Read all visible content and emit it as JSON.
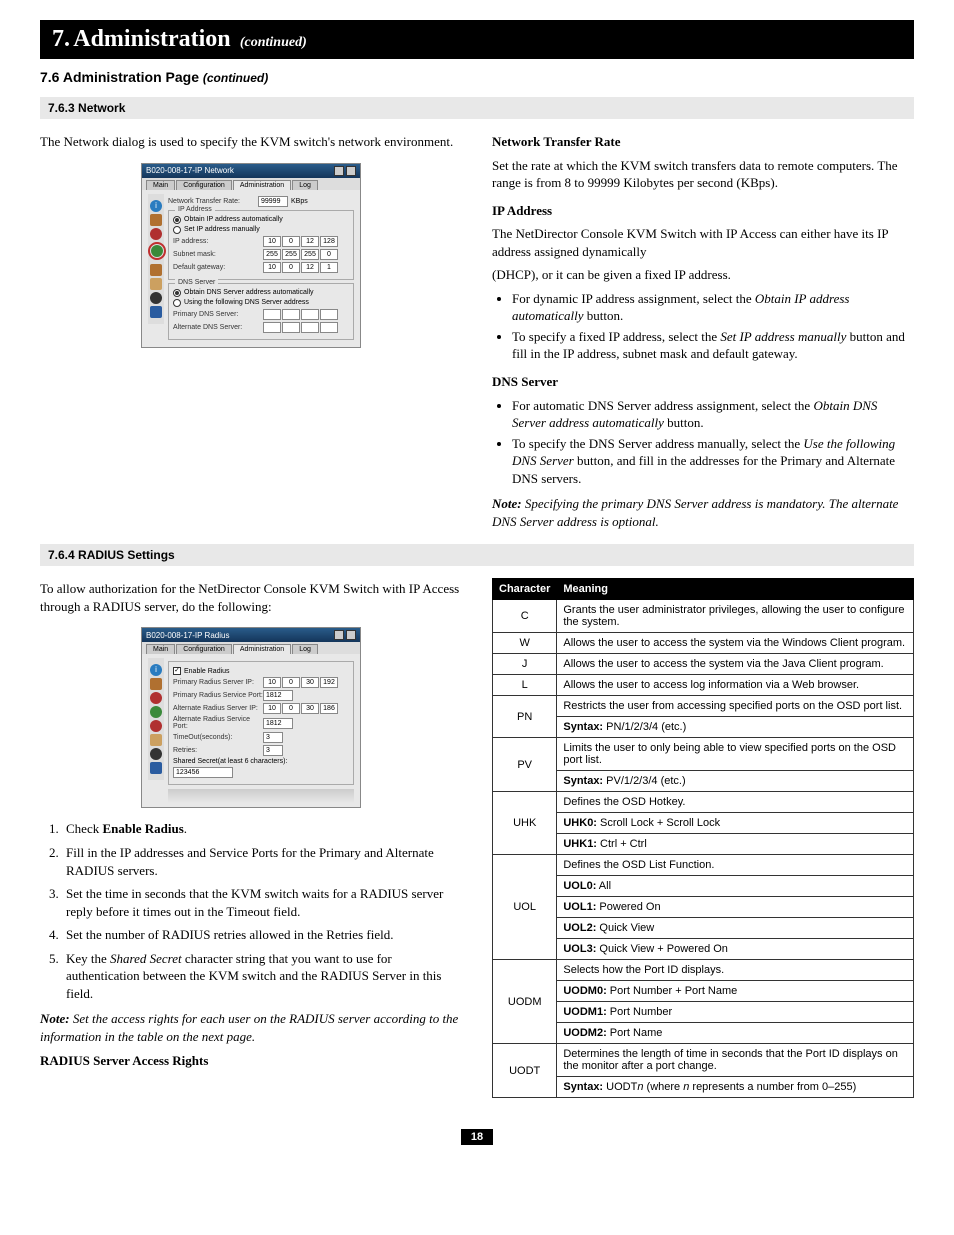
{
  "chapter": {
    "num": "7.",
    "title": "Administration",
    "continued": "(continued)"
  },
  "section": {
    "num": "7.6",
    "title": "Administration Page",
    "continued": "(continued)"
  },
  "sub763": {
    "num": "7.6.3",
    "title": "Network"
  },
  "sub764": {
    "num": "7.6.4",
    "title": "RADIUS Settings"
  },
  "intro763": "The Network dialog is used to specify the KVM switch's network environment.",
  "ntr": {
    "heading": "Network Transfer Rate",
    "body": "Set the rate at which the KVM switch transfers data to remote computers. The range is from 8 to 99999 Kilobytes per second (KBps)."
  },
  "ip": {
    "heading": "IP Address",
    "lead": "The NetDirector Console KVM Switch with IP Access can either have its IP address assigned dynamically",
    "lead2": "(DHCP), or it can be given a fixed IP address.",
    "b1a": "For dynamic IP address assignment, select the ",
    "b1i": "Obtain IP address automatically",
    "b1b": " button.",
    "b2a": "To specify a fixed IP address, select the ",
    "b2i": "Set IP address manually",
    "b2b": " button and fill in the IP address, subnet mask and default gateway."
  },
  "dns": {
    "heading": "DNS Server",
    "b1a": "For automatic DNS Server address assignment, select the ",
    "b1i": "Obtain DNS Server address automatically",
    "b1b": " button.",
    "b2a": "To specify the DNS Server address manually, select the ",
    "b2i": "Use the following DNS Server",
    "b2b": " button, and fill in the addresses for the Primary and Alternate DNS servers.",
    "noteLabel": "Note:",
    "noteBody": " Specifying the primary DNS Server address is mandatory. The alternate DNS Server address is optional."
  },
  "radius": {
    "intro": "To allow authorization for the NetDirector Console KVM Switch with IP Access through a RADIUS server, do the following:",
    "steps": {
      "s1a": "Check ",
      "s1b": "Enable Radius",
      "s1c": ".",
      "s2": "Fill in the IP addresses and Service Ports for the Primary and Alternate RADIUS servers.",
      "s3": "Set the time in seconds that the KVM switch waits for a RADIUS server reply before it times out in the Timeout field.",
      "s4": "Set the number of RADIUS retries allowed in the Retries field.",
      "s5a": "Key the ",
      "s5i": "Shared Secret",
      "s5b": " character string that you want to use for authentication between the KVM switch and the RADIUS Server in this field."
    },
    "noteLabel": "Note:",
    "noteBody": " Set the access rights for each user on the RADIUS server according to the information in the table on the next page.",
    "accessHeading": "RADIUS Server Access Rights"
  },
  "table": {
    "hChar": "Character",
    "hMean": "Meaning",
    "rows": [
      {
        "c": "C",
        "m": [
          "Grants the user administrator privileges, allowing the user to configure the system."
        ]
      },
      {
        "c": "W",
        "m": [
          "Allows the user to access the system via the Windows Client program."
        ]
      },
      {
        "c": "J",
        "m": [
          "Allows the user to access the system via the Java Client program."
        ]
      },
      {
        "c": "L",
        "m": [
          "Allows the user to access log information via a Web browser."
        ]
      },
      {
        "c": "PN",
        "m": [
          "Restricts the user from accessing specified ports on the OSD port list.",
          "<b>Syntax:</b> PN/1/2/3/4 (etc.)"
        ]
      },
      {
        "c": "PV",
        "m": [
          "Limits the user to only being able to view specified ports on the OSD port list.",
          "<b>Syntax:</b> PV/1/2/3/4 (etc.)"
        ]
      },
      {
        "c": "UHK",
        "m": [
          "Defines the OSD Hotkey.",
          "<b>UHK0:</b> Scroll Lock + Scroll Lock",
          "<b>UHK1:</b> Ctrl + Ctrl"
        ]
      },
      {
        "c": "UOL",
        "m": [
          "Defines the OSD List Function.",
          "<b>UOL0:</b> All",
          "<b>UOL1:</b> Powered On",
          "<b>UOL2:</b> Quick View",
          "<b>UOL3:</b> Quick View + Powered On"
        ]
      },
      {
        "c": "UODM",
        "m": [
          "Selects how the Port ID displays.",
          "<b>UODM0:</b> Port Number + Port Name",
          "<b>UODM1:</b> Port Number",
          "<b>UODM2:</b> Port Name"
        ]
      },
      {
        "c": "UODT",
        "m": [
          "Determines the length of time in seconds that the Port ID displays on the monitor after a port change.",
          "<b>Syntax:</b> UODT<i>n</i> (where <i>n</i> represents a number from 0–255)"
        ]
      }
    ]
  },
  "ssNet": {
    "title": "B020-008-17-IP Network",
    "tabs": [
      "Main",
      "Configuration",
      "Administration",
      "Log"
    ],
    "ntrLabel": "Network Transfer Rate:",
    "ntrVal": "99999",
    "ntrUnit": "KBps",
    "gIP": "IP Address",
    "r1": "Obtain IP address automatically",
    "r2": "Set IP address manually",
    "ipL": "IP address:",
    "ipV": [
      "10",
      "0",
      "12",
      "128"
    ],
    "smL": "Subnet mask:",
    "smV": [
      "255",
      "255",
      "255",
      "0"
    ],
    "gwL": "Default gateway:",
    "gwV": [
      "10",
      "0",
      "12",
      "1"
    ],
    "gDNS": "DNS Server",
    "d1": "Obtain DNS Server address automatically",
    "d2": "Using the following DNS Server address",
    "pdnsL": "Primary DNS Server:",
    "adnsL": "Alternate DNS Server:"
  },
  "ssRad": {
    "title": "B020-008-17-IP Radius",
    "tabs": [
      "Main",
      "Configuration",
      "Administration",
      "Log"
    ],
    "enable": "Enable Radius",
    "psL": "Primary Radius Server IP:",
    "psV": [
      "10",
      "0",
      "30",
      "192"
    ],
    "pspL": "Primary Radius Service Port:",
    "pspV": "1812",
    "asL": "Alternate Radius Server IP:",
    "asV": [
      "10",
      "0",
      "30",
      "186"
    ],
    "aspL": "Alternate Radius Service Port:",
    "aspV": "1812",
    "toL": "TimeOut(seconds):",
    "toV": "3",
    "reL": "Retries:",
    "reV": "3",
    "ssL": "Shared Secret(at least 6 characters):",
    "ssV": "123456"
  },
  "pageNum": "18"
}
